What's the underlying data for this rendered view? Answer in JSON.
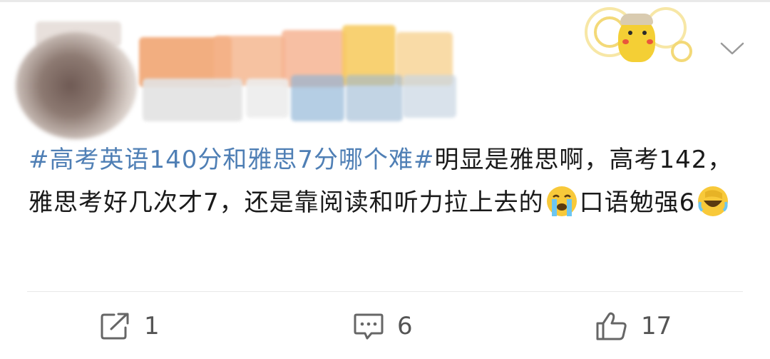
{
  "post": {
    "topic": "#高考英语140分和雅思7分哪个难#",
    "text_part1": "明显是雅思啊，高考142，雅思考好几次才7，还是靠阅读和听力拉上去的",
    "text_part2": "口语勉强6"
  },
  "emojis": [
    "crying-face-emoji",
    "laughing-facepalm-emoji"
  ],
  "actions": {
    "share_count": "1",
    "comment_count": "6",
    "like_count": "17"
  },
  "icons": [
    "share-icon",
    "comment-icon",
    "like-icon",
    "chevron-down-icon"
  ],
  "colors": {
    "topic": "#4f7fb5",
    "text": "#1a1a1a",
    "action_gray": "#555555"
  }
}
